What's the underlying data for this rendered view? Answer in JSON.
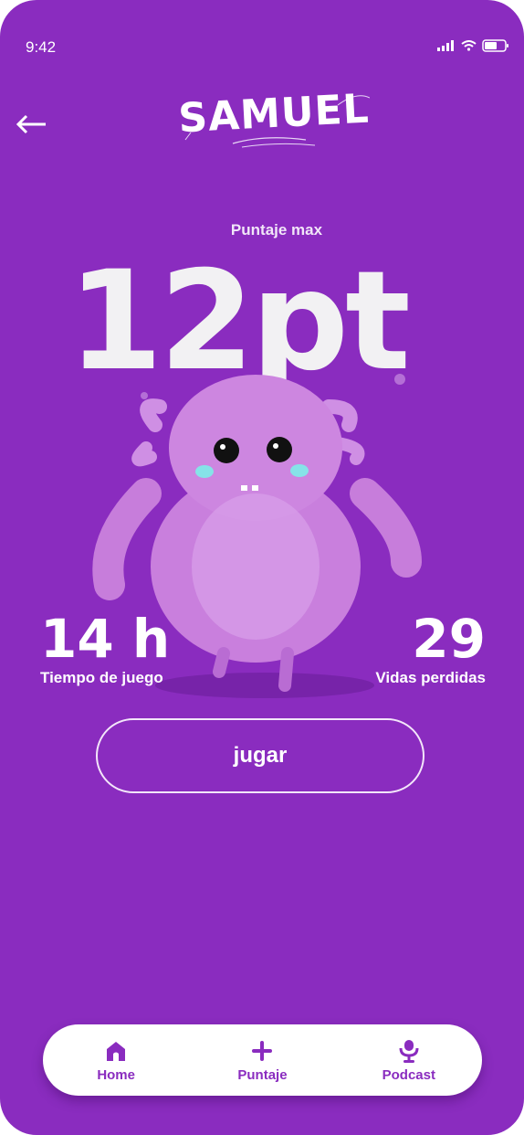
{
  "status_bar": {
    "time": "9:42"
  },
  "header": {
    "logo_text": "SAMUEL"
  },
  "score": {
    "label": "Puntaje max",
    "value": "12pt"
  },
  "stats": {
    "play_time": {
      "value": "14 h",
      "label": "Tiempo de juego"
    },
    "lives_lost": {
      "value": "29",
      "label": "Vidas perdidas"
    }
  },
  "actions": {
    "play_label": "jugar"
  },
  "nav": {
    "items": [
      {
        "label": "Home",
        "icon": "home-icon"
      },
      {
        "label": "Puntaje",
        "icon": "plus-icon"
      },
      {
        "label": "Podcast",
        "icon": "podcast-icon"
      }
    ]
  },
  "colors": {
    "background": "#8a2cbf",
    "accent": "#8a2cbf",
    "nav_bg": "#ffffff",
    "monster": "#c77ddb"
  }
}
